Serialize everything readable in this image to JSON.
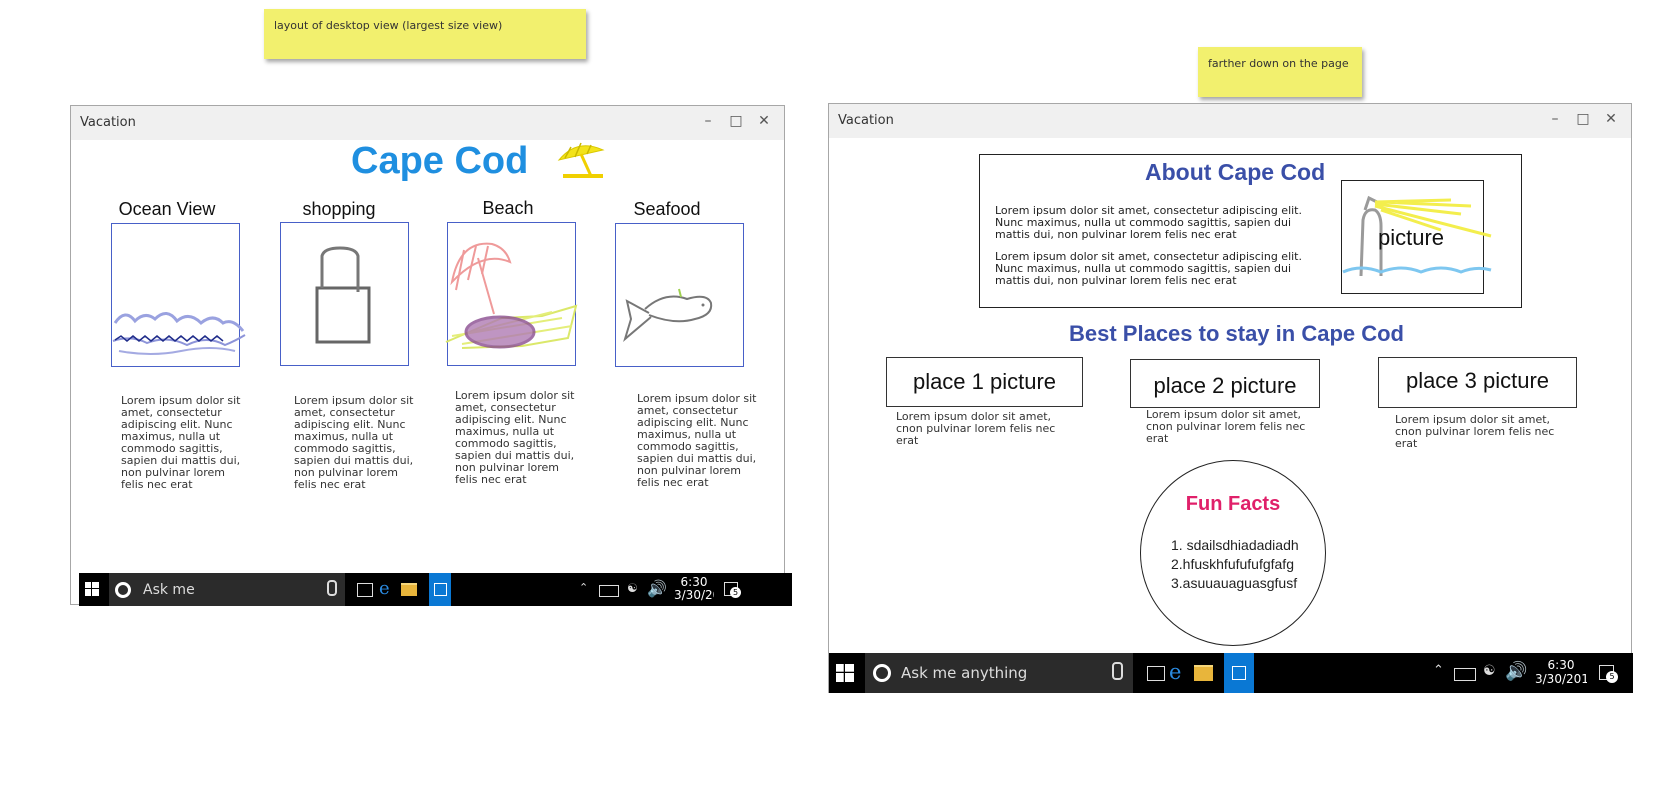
{
  "notes": {
    "note1": "layout of desktop view (largest size view)",
    "note2": "farther down on the page"
  },
  "left_window": {
    "title": "Vacation",
    "heading": "Cape Cod",
    "categories": [
      {
        "label": "Ocean View",
        "text": "Lorem ipsum dolor sit amet, consectetur adipiscing elit. Nunc maximus, nulla ut commodo sagittis, sapien dui mattis dui, non pulvinar lorem felis nec erat"
      },
      {
        "label": "shopping",
        "text": "Lorem ipsum dolor sit amet, consectetur adipiscing elit. Nunc maximus, nulla ut commodo sagittis, sapien dui mattis dui, non pulvinar lorem felis nec erat"
      },
      {
        "label": "Beach",
        "text": "Lorem ipsum dolor sit amet, consectetur adipiscing elit. Nunc maximus, nulla ut commodo sagittis, sapien dui mattis dui, non pulvinar lorem felis nec erat"
      },
      {
        "label": "Seafood",
        "text": "Lorem ipsum dolor sit amet, consectetur adipiscing elit. Nunc maximus, nulla ut commodo sagittis, sapien dui mattis dui, non pulvinar lorem felis nec erat"
      }
    ],
    "taskbar": {
      "search": "Ask me",
      "time": "6:30",
      "date": "3/30/20",
      "badge": "5"
    }
  },
  "right_window": {
    "title": "Vacation",
    "about_title": "About Cape Cod",
    "about_p1": "Lorem ipsum dolor sit amet, consectetur adipiscing elit. Nunc maximus, nulla ut commodo sagittis, sapien dui mattis dui, non pulvinar lorem felis nec erat",
    "about_p2": "Lorem ipsum dolor sit amet, consectetur adipiscing elit. Nunc maximus, nulla ut commodo sagittis, sapien dui mattis dui, non pulvinar lorem felis nec erat",
    "picture_label": "picture",
    "places_title": "Best Places to stay in Cape Cod",
    "places": [
      {
        "label": "place 1 picture",
        "caption": "Lorem ipsum dolor sit amet, cnon pulvinar lorem felis nec erat"
      },
      {
        "label": "place 2 picture",
        "caption": "Lorem ipsum dolor sit amet, cnon pulvinar lorem felis nec erat"
      },
      {
        "label": "place 3 picture",
        "caption": "Lorem ipsum dolor sit amet, cnon pulvinar lorem felis nec erat"
      }
    ],
    "fun_facts": {
      "title": "Fun Facts",
      "items": [
        "1. sdailsdhiadadiadh",
        "2.hfuskhfufufufgfafg",
        "3.asuuauaguasgfusf"
      ]
    },
    "taskbar": {
      "search": "Ask me anything",
      "time": "6:30",
      "date": "3/30/201",
      "badge": "5"
    }
  },
  "colors": {
    "heading": "#1f8fe0",
    "navy": "#3a4fa8",
    "fun_facts": "#e0206a",
    "sticky": "#f2f06e",
    "store": "#0a78d4"
  }
}
